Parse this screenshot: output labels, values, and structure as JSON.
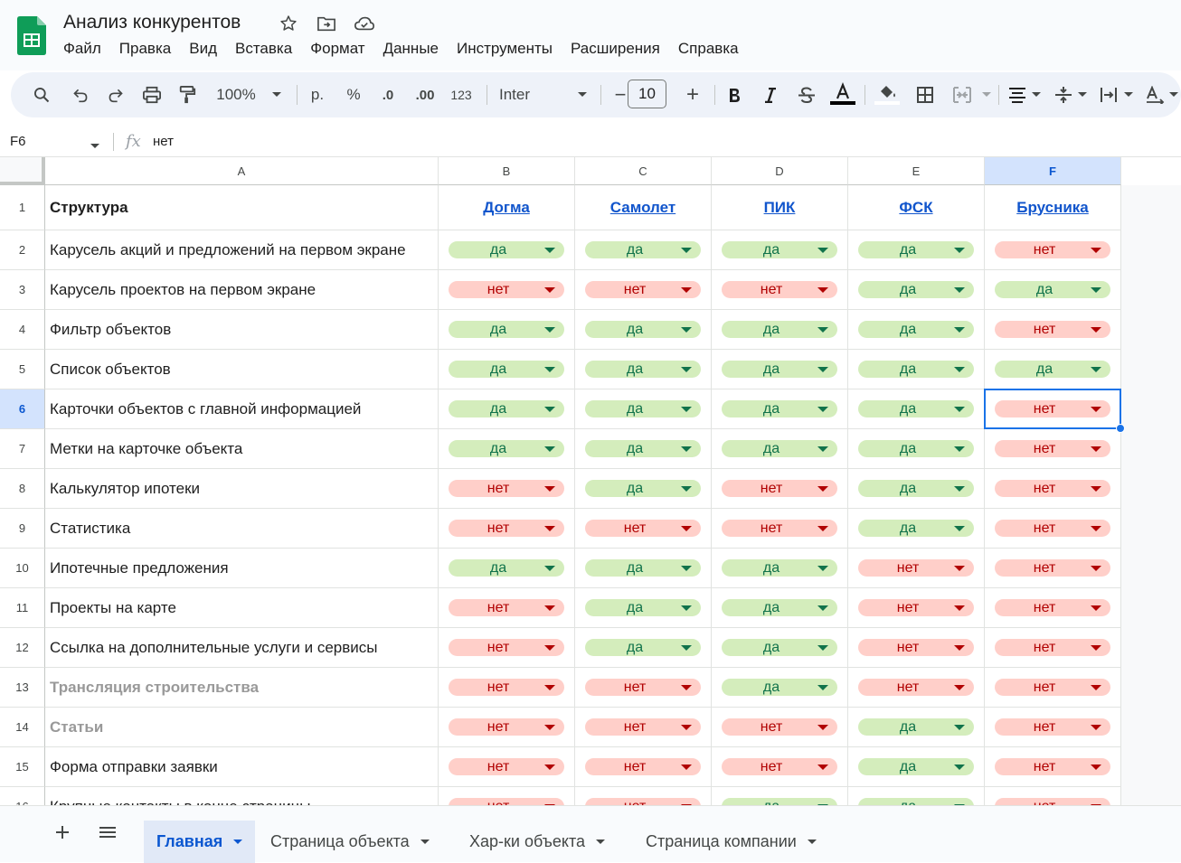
{
  "app": {
    "title": "Анализ конкурентов",
    "menu": [
      "Файл",
      "Правка",
      "Вид",
      "Вставка",
      "Формат",
      "Данные",
      "Инструменты",
      "Расширения",
      "Справка"
    ]
  },
  "toolbar": {
    "zoom": "100%",
    "currency": "р.",
    "percent": "%",
    "decrease_decimal": ".0",
    "increase_decimal": ".00",
    "number_format": "123",
    "font": "Inter",
    "font_size": "10",
    "minus": "−",
    "plus": "+"
  },
  "formula_bar": {
    "cell_ref": "F6",
    "fx": "fx",
    "value": "нет"
  },
  "columns": [
    "A",
    "B",
    "C",
    "D",
    "E",
    "F"
  ],
  "header_row": {
    "num": "1",
    "label": "Структура",
    "competitors": [
      "Догма",
      "Самолет",
      "ПИК",
      "ФСК",
      "Брусника"
    ]
  },
  "rows": [
    {
      "num": "2",
      "label": "Карусель акций и предложений на первом экране",
      "style": "normal",
      "values": [
        "да",
        "да",
        "да",
        "да",
        "нет"
      ]
    },
    {
      "num": "3",
      "label": "Карусель проектов на первом экране",
      "style": "normal",
      "values": [
        "нет",
        "нет",
        "нет",
        "да",
        "да"
      ]
    },
    {
      "num": "4",
      "label": "Фильтр объектов",
      "style": "normal",
      "values": [
        "да",
        "да",
        "да",
        "да",
        "нет"
      ]
    },
    {
      "num": "5",
      "label": "Список объектов",
      "style": "normal",
      "values": [
        "да",
        "да",
        "да",
        "да",
        "да"
      ]
    },
    {
      "num": "6",
      "label": "Карточки объектов с главной информацией",
      "style": "normal",
      "values": [
        "да",
        "да",
        "да",
        "да",
        "нет"
      ]
    },
    {
      "num": "7",
      "label": "Метки на карточке объекта",
      "style": "normal",
      "values": [
        "да",
        "да",
        "да",
        "да",
        "нет"
      ]
    },
    {
      "num": "8",
      "label": "Калькулятор ипотеки",
      "style": "normal",
      "values": [
        "нет",
        "да",
        "нет",
        "да",
        "нет"
      ]
    },
    {
      "num": "9",
      "label": "Статистика",
      "style": "normal",
      "values": [
        "нет",
        "нет",
        "нет",
        "да",
        "нет"
      ]
    },
    {
      "num": "10",
      "label": "Ипотечные предложения",
      "style": "normal",
      "values": [
        "да",
        "да",
        "да",
        "нет",
        "нет"
      ]
    },
    {
      "num": "11",
      "label": "Проекты на карте",
      "style": "normal",
      "values": [
        "нет",
        "да",
        "да",
        "нет",
        "нет"
      ]
    },
    {
      "num": "12",
      "label": "Ссылка на дополнительные услуги и сервисы",
      "style": "normal",
      "values": [
        "нет",
        "да",
        "да",
        "нет",
        "нет"
      ]
    },
    {
      "num": "13",
      "label": "Трансляция строительства",
      "style": "muted",
      "values": [
        "нет",
        "нет",
        "да",
        "нет",
        "нет"
      ]
    },
    {
      "num": "14",
      "label": "Статьи",
      "style": "muted",
      "values": [
        "нет",
        "нет",
        "нет",
        "да",
        "нет"
      ]
    },
    {
      "num": "15",
      "label": "Форма отправки заявки",
      "style": "normal",
      "values": [
        "нет",
        "нет",
        "нет",
        "да",
        "нет"
      ]
    },
    {
      "num": "16",
      "label": "Крупные контакты в конце страницы",
      "style": "normal",
      "values": [
        "нет",
        "нет",
        "да",
        "да",
        "нет"
      ]
    }
  ],
  "selected": {
    "column": "F",
    "row": "6"
  },
  "colors": {
    "yes_bg": "#d4edbc",
    "yes_text": "#11734b",
    "no_bg": "#ffcfc9",
    "no_text": "#b10202",
    "accent": "#0b57d0"
  },
  "sheets": [
    {
      "label": "Главная",
      "active": true
    },
    {
      "label": "Страница объекта",
      "active": false
    },
    {
      "label": "Хар-ки объекта",
      "active": false
    },
    {
      "label": "Страница компании",
      "active": false
    }
  ]
}
